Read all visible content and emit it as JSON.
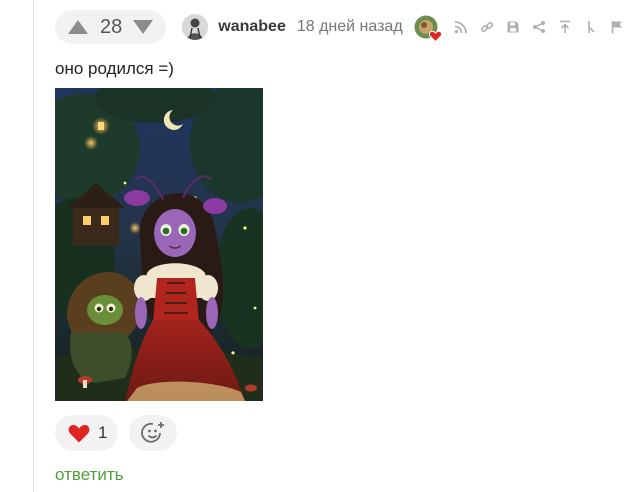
{
  "comment": {
    "rating": "28",
    "author": "wanabee",
    "time_ago": "18 дней назад",
    "text": "оно родился =)",
    "reactions": {
      "likes": "1"
    },
    "reply_label": "ответить"
  },
  "icons": {
    "upvote": "triangle-up-icon",
    "downvote": "triangle-down-icon",
    "actions": [
      "rss-icon",
      "link-icon",
      "save-icon",
      "share-icon",
      "arrow-up-icon",
      "branch-icon",
      "flag-icon"
    ],
    "like": "heart-icon",
    "add_reaction": "smiley-plus-icon"
  },
  "colors": {
    "heart": "#e02424",
    "reply": "#4f9f3c",
    "chip_bg": "#f2f2f2"
  }
}
